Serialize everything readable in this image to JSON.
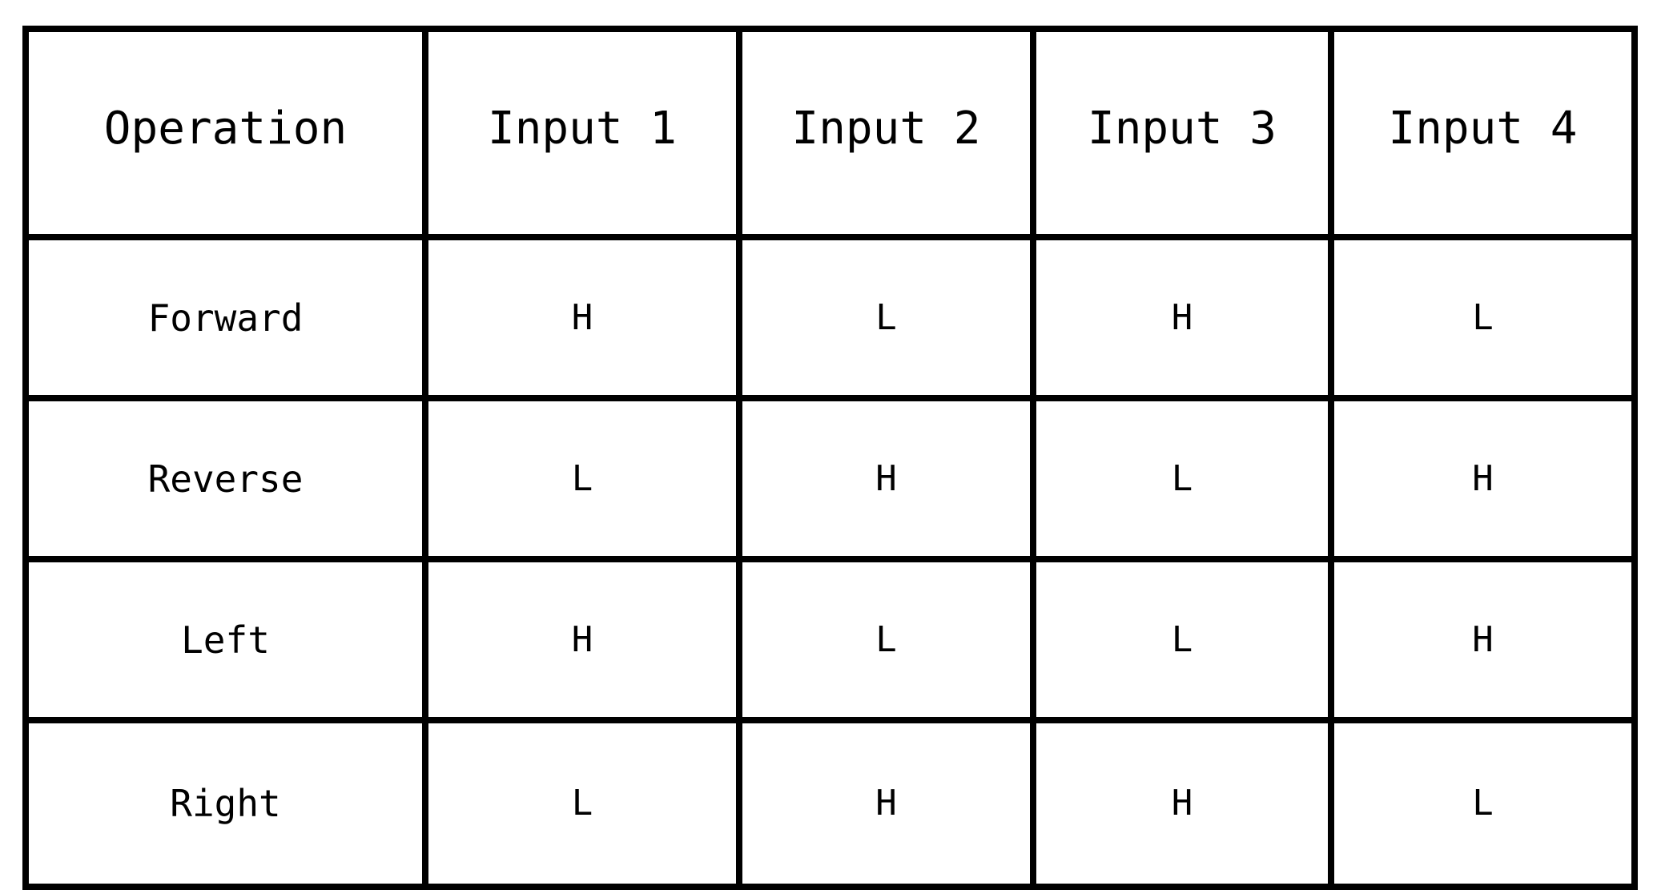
{
  "table": {
    "columns": [
      {
        "key": "operation",
        "label": "Operation"
      },
      {
        "key": "input1",
        "label": "Input 1"
      },
      {
        "key": "input2",
        "label": "Input 2"
      },
      {
        "key": "input3",
        "label": "Input 3"
      },
      {
        "key": "input4",
        "label": "Input 4"
      }
    ],
    "rows": [
      {
        "operation": "Forward",
        "input1": "H",
        "input2": "L",
        "input3": "H",
        "input4": "L"
      },
      {
        "operation": "Reverse",
        "input1": "L",
        "input2": "H",
        "input3": "L",
        "input4": "H"
      },
      {
        "operation": "Left",
        "input1": "H",
        "input2": "L",
        "input3": "L",
        "input4": "H"
      },
      {
        "operation": "Right",
        "input1": "L",
        "input2": "H",
        "input3": "H",
        "input4": "L"
      }
    ]
  },
  "style": {
    "border_color": "#000000",
    "background_color": "#ffffff",
    "text_color": "#000000"
  }
}
